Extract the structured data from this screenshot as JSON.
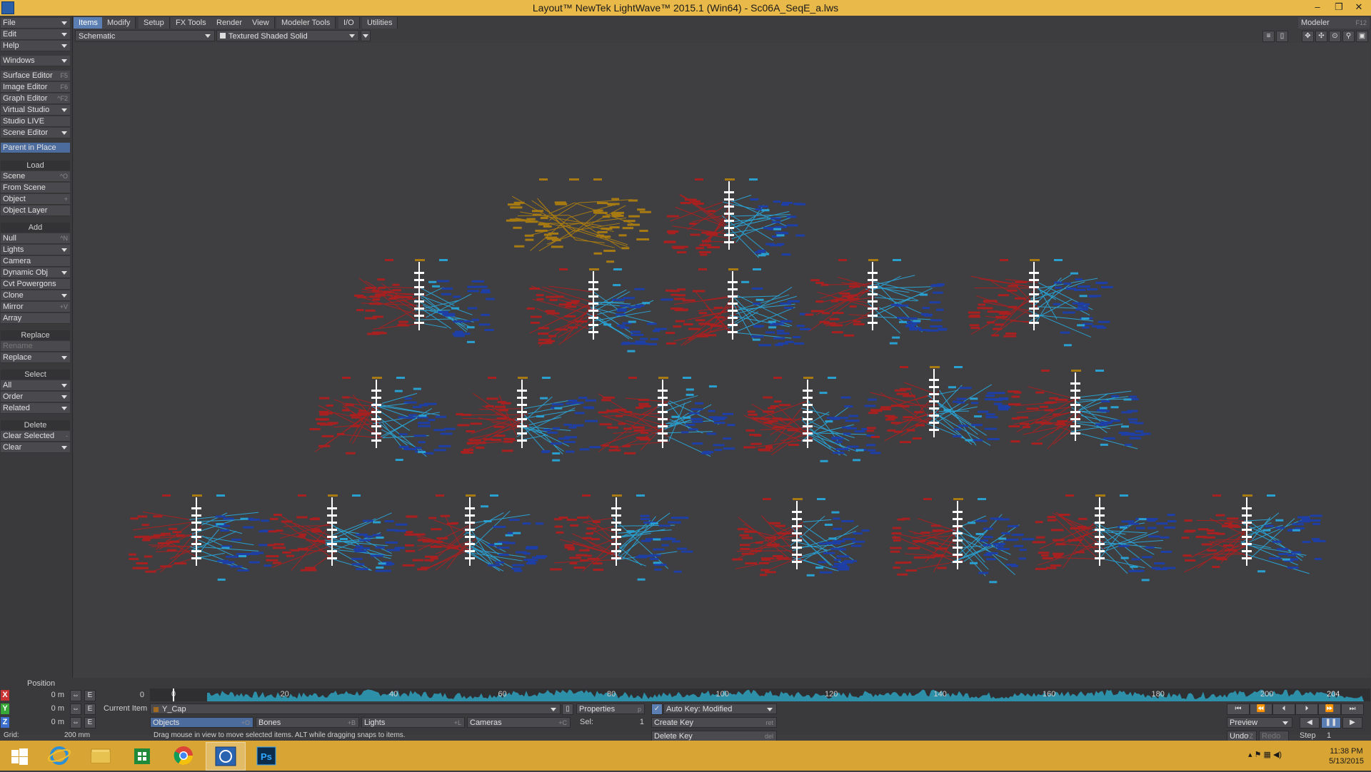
{
  "window": {
    "title": "Layout™ NewTek LightWave™ 2015.1 (Win64) - Sc06A_SeqE_a.lws",
    "controls": [
      "–",
      "❐",
      "✕"
    ]
  },
  "left_panel": {
    "top_menus": [
      {
        "label": "File"
      },
      {
        "label": "Edit"
      },
      {
        "label": "Help"
      },
      {
        "label": "Windows"
      }
    ],
    "editors": [
      {
        "label": "Surface Editor",
        "shortcut": "F5"
      },
      {
        "label": "Image Editor",
        "shortcut": "F6"
      },
      {
        "label": "Graph Editor",
        "shortcut": "^F2"
      },
      {
        "label": "Virtual Studio",
        "shortcut": ""
      },
      {
        "label": "Studio LIVE",
        "shortcut": ""
      },
      {
        "label": "Scene Editor",
        "shortcut": ""
      }
    ],
    "parent_in_place": "Parent in Place",
    "load": {
      "heading": "Load",
      "items": [
        {
          "label": "Scene",
          "shortcut": "^O"
        },
        {
          "label": "From Scene",
          "shortcut": ""
        },
        {
          "label": "Object",
          "shortcut": "+"
        },
        {
          "label": "Object Layer",
          "shortcut": ""
        }
      ]
    },
    "add": {
      "heading": "Add",
      "items": [
        {
          "label": "Null",
          "shortcut": "^N"
        },
        {
          "label": "Lights",
          "shortcut": ""
        },
        {
          "label": "Camera",
          "shortcut": ""
        },
        {
          "label": "Dynamic Obj",
          "shortcut": ""
        },
        {
          "label": "Cvt Powergons",
          "shortcut": ""
        },
        {
          "label": "Clone",
          "shortcut": ""
        },
        {
          "label": "Mirror",
          "shortcut": "+V"
        },
        {
          "label": "Array",
          "shortcut": ""
        }
      ]
    },
    "replace": {
      "heading": "Replace",
      "items": [
        {
          "label": "Rename",
          "shortcut": ""
        },
        {
          "label": "Replace",
          "shortcut": ""
        }
      ]
    },
    "select": {
      "heading": "Select",
      "items": [
        {
          "label": "All"
        },
        {
          "label": "Order"
        },
        {
          "label": "Related"
        }
      ]
    },
    "delete": {
      "heading": "Delete",
      "items": [
        {
          "label": "Clear Selected",
          "shortcut": "-"
        },
        {
          "label": "Clear",
          "shortcut": ""
        }
      ]
    }
  },
  "tabs": [
    "Items",
    "Modify",
    "Setup",
    "FX Tools",
    "Render",
    "View",
    "Modeler Tools",
    "I/O",
    "Utilities"
  ],
  "active_tab": "Items",
  "modeler_button": {
    "label": "Modeler",
    "shortcut": "F12"
  },
  "viewbar": {
    "view_mode": "Schematic",
    "render_mode": "Textured Shaded Solid"
  },
  "bottom": {
    "position_label": "Position",
    "axes": [
      {
        "axis": "X",
        "value": "0 m",
        "color": "#c83232"
      },
      {
        "axis": "Y",
        "value": "0 m",
        "color": "#38a838"
      },
      {
        "axis": "Z",
        "value": "0 m",
        "color": "#3c6fd0"
      }
    ],
    "frame_value": "0",
    "timeline_ticks": [
      "0",
      "20",
      "40",
      "60",
      "80",
      "100",
      "120",
      "140",
      "160",
      "180",
      "200"
    ],
    "end_frame": "204",
    "current_item_label": "Current Item",
    "current_item": "Y_Cap",
    "properties": {
      "label": "Properties",
      "shortcut": "p"
    },
    "auto_key": "Auto Key: Modified",
    "create_key": {
      "label": "Create Key",
      "shortcut": "ret"
    },
    "delete_key": {
      "label": "Delete Key",
      "shortcut": "del"
    },
    "objects": {
      "label": "Objects",
      "shortcut": "+O"
    },
    "bones": {
      "label": "Bones",
      "shortcut": "+B"
    },
    "lights": {
      "label": "Lights",
      "shortcut": "+L"
    },
    "cameras": {
      "label": "Cameras",
      "shortcut": "+C"
    },
    "sel_label": "Sel:",
    "sel_value": "1",
    "grid_label": "Grid:",
    "grid_value": "200 mm",
    "status": "Drag mouse in view to move selected items. ALT while dragging snaps to items.",
    "preview": "Preview",
    "undo": {
      "label": "Undo",
      "shortcut": "^Z"
    },
    "redo": "Redo",
    "step_label": "Step",
    "step_value": "1"
  },
  "tray": {
    "time": "11:38 PM",
    "date": "5/13/2015"
  },
  "taskbar_apps": [
    "start-icon",
    "internet-explorer-icon",
    "file-explorer-icon",
    "store-icon",
    "chrome-icon",
    "lightwave-icon",
    "photoshop-icon"
  ],
  "colors": {
    "title_bar": "#e9b94a",
    "taskbar": "#d8a534",
    "accent": "#5b7fb3",
    "node_red": "#a82020",
    "node_blue": "#1e3fa6",
    "node_white": "#ffffff",
    "node_cyan": "#2aa0d0",
    "node_gold": "#a77a12"
  }
}
